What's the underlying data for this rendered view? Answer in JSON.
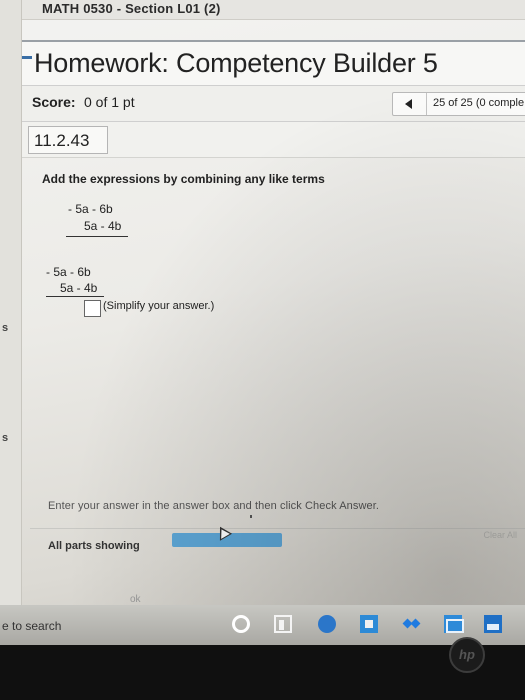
{
  "course": {
    "title": "MATH 0530 - Section L01 (2)"
  },
  "homework": {
    "title": "Homework: Competency Builder 5"
  },
  "score": {
    "label": "Score:",
    "value": "0 of 1 pt"
  },
  "nav": {
    "position_text": "25 of 25 (0 comple"
  },
  "question": {
    "number": "11.2.43",
    "prompt": "Add the expressions by combining any like terms",
    "expr_top": [
      "- 5a - 6b",
      "5a - 4b"
    ],
    "expr_answer": [
      "- 5a - 6b",
      "5a - 4b"
    ],
    "answer_value": "",
    "simplify_hint": "(Simplify your answer.)"
  },
  "footer": {
    "instruction": "Enter your answer in the answer box and then click Check Answer.",
    "parts_label": "All parts showing",
    "clear_all": "Clear All",
    "ok": "ok"
  },
  "gutter": {
    "s1": "s",
    "s2": "s"
  },
  "taskbar": {
    "search_text": "e to search",
    "icons": [
      "cortana-icon",
      "task-view-icon",
      "edge-icon",
      "store-icon",
      "dropbox-icon",
      "mail-icon",
      "photos-icon"
    ]
  },
  "device": {
    "logo": "hp"
  },
  "colors": {
    "progress": "#5da6d6",
    "taskbar": "#b5b4af",
    "edge": "#2b76c9"
  }
}
